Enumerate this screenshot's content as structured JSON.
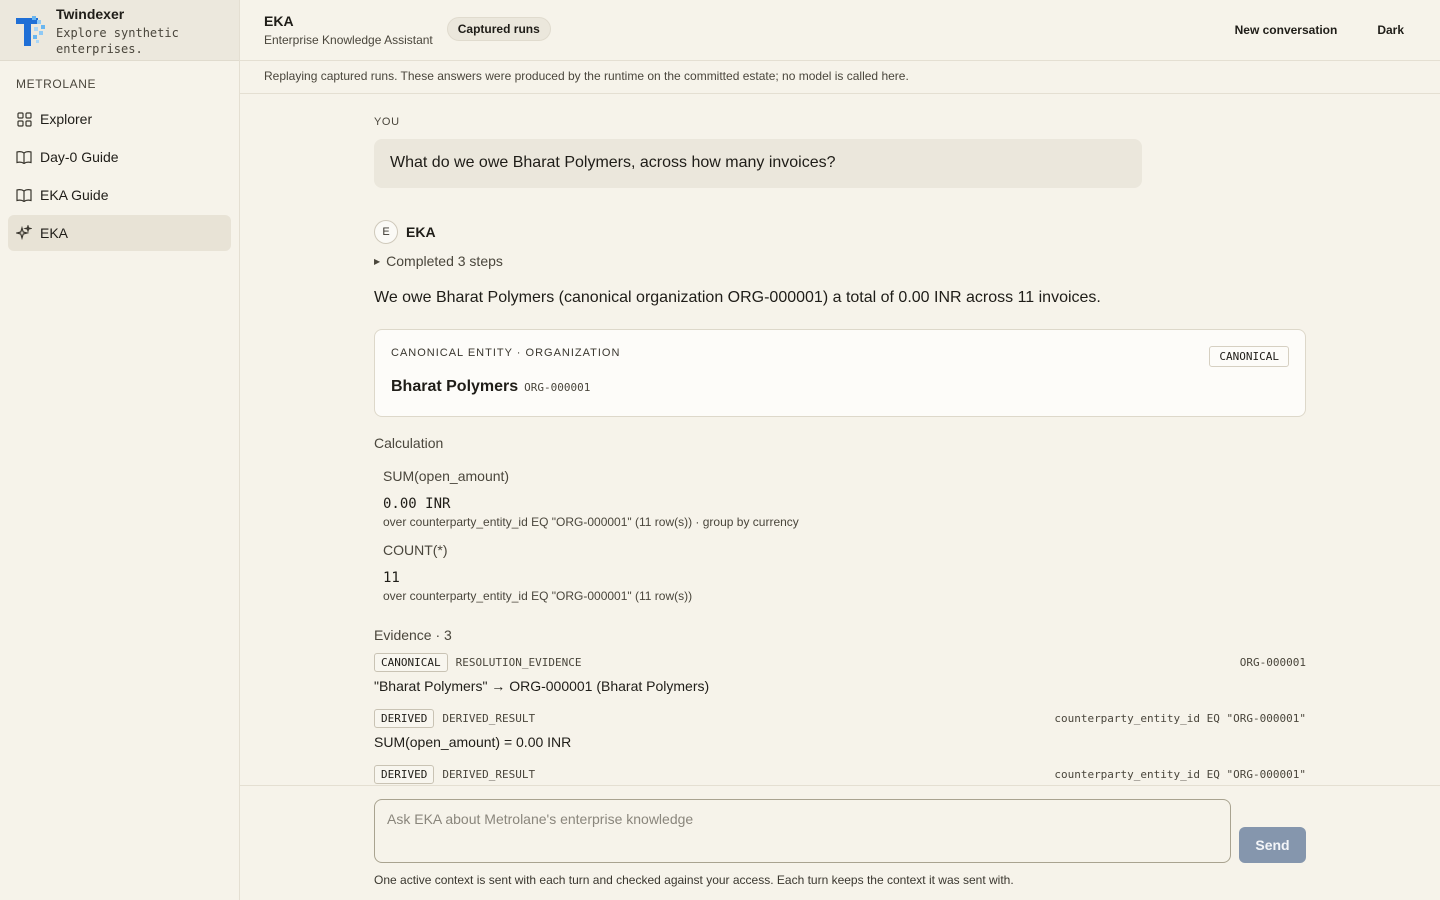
{
  "brand": {
    "name": "Twindexer",
    "tagline": "Explore synthetic enterprises."
  },
  "sidebar": {
    "org": "METROLANE",
    "items": [
      {
        "label": "Explorer",
        "icon": "grid-icon",
        "active": false
      },
      {
        "label": "Day-0 Guide",
        "icon": "book-icon",
        "active": false
      },
      {
        "label": "EKA Guide",
        "icon": "book-icon",
        "active": false
      },
      {
        "label": "EKA",
        "icon": "sparkle-icon",
        "active": true
      }
    ]
  },
  "header": {
    "title": "EKA",
    "subtitle": "Enterprise Knowledge Assistant",
    "pill": "Captured runs",
    "new_conversation": "New conversation",
    "theme": "Dark"
  },
  "banner": "Replaying captured runs. These answers were produced by the runtime on the committed estate; no model is called here.",
  "conversation": {
    "you_label": "YOU",
    "question": "What do we owe Bharat Polymers, across how many invoices?",
    "assistant_avatar": "E",
    "assistant_name": "EKA",
    "steps": "Completed 3 steps",
    "answer": "We owe Bharat Polymers (canonical organization ORG-000001) a total of 0.00 INR across 11 invoices.",
    "entity_card": {
      "kicker": "CANONICAL ENTITY · ORGANIZATION",
      "badge": "CANONICAL",
      "name": "Bharat Polymers",
      "id": "ORG-000001"
    },
    "calculation": {
      "heading": "Calculation",
      "items": [
        {
          "fn": "SUM(open_amount)",
          "value": "0.00 INR",
          "note": "over counterparty_entity_id EQ \"ORG-000001\" (11 row(s)) · group by currency"
        },
        {
          "fn": "COUNT(*)",
          "value": "11",
          "note": "over counterparty_entity_id EQ \"ORG-000001\" (11 row(s))"
        }
      ]
    },
    "evidence": {
      "heading": "Evidence · 3",
      "items": [
        {
          "tag": "CANONICAL",
          "kind": "RESOLUTION_EVIDENCE",
          "ref": "ORG-000001",
          "text": "\"Bharat Polymers\" → ORG-000001 (Bharat Polymers)"
        },
        {
          "tag": "DERIVED",
          "kind": "DERIVED_RESULT",
          "ref": "counterparty_entity_id EQ \"ORG-000001\"",
          "text": "SUM(open_amount) = 0.00 INR"
        },
        {
          "tag": "DERIVED",
          "kind": "DERIVED_RESULT",
          "ref": "counterparty_entity_id EQ \"ORG-000001\"",
          "text": ""
        }
      ]
    }
  },
  "composer": {
    "placeholder": "Ask EKA about Metrolane's enterprise knowledge",
    "send": "Send",
    "footnote": "One active context is sent with each turn and checked against your access. Each turn keeps the context it was sent with."
  },
  "colors": {
    "send_button": "#8596ad",
    "active_nav": "#e8e3d6",
    "logo_primary": "#1f6fd6",
    "logo_accent": "#69b6f0"
  }
}
